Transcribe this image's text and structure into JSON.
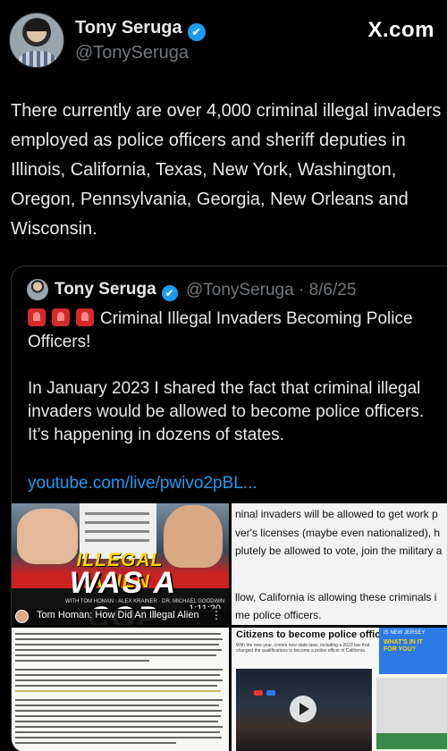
{
  "header": {
    "author_name": "Tony Seruga",
    "author_handle": "@TonySeruga",
    "site_brand": "X.com",
    "verified_icon": "✔"
  },
  "tweet": {
    "text": "There currently are over 4,000 criminal illegal invaders employed as police officers and sheriff deputies in Illinois, California, Texas, New York, Washington, Oregon, Pennsylvania, Georgia, New Orleans and Wisconsin."
  },
  "quote": {
    "author_name": "Tony Seruga",
    "handle_and_date": "@TonySeruga · 8/6/25",
    "verified_icon": "✔",
    "headline": "Criminal Illegal Invaders Becoming Police Officers!",
    "body": "In January 2023 I shared the fact that criminal illegal invaders would be allowed to become police officers. It’s happening in dozens of states.",
    "link": "youtube.com/live/pwivo2pBL..."
  },
  "media": {
    "video": {
      "headline_1": "ILLEGAL ALIEN",
      "headline_2": "WAS A COP",
      "credits": "WITH TOM HOMAN · ALEX KRAINER · DR. MICHAEL GOODWIN",
      "duration": "1:11:20",
      "caption": "Tom Homan: How Did An Illegal Alien",
      "more_icon": "⋮"
    },
    "text_snippet": {
      "lines": [
        "ninal invaders will be allowed to get work p",
        "ver's licenses (maybe even nationalized), h",
        "plutely be allowed to vote, join the military a",
        "llow, California is allowing these criminals i",
        "me police officers."
      ]
    },
    "news": {
      "title": "Citizens to become police officers",
      "body_1": "With the new year, comes new state laws, including a 2023 law that",
      "body_2": "changed the qualifications to become a police officer in California.",
      "ad_1": "IS NEW JERSEY",
      "ad_2": "WHAT'S IN IT FOR YOU?"
    }
  },
  "colors": {
    "background": "#000000",
    "text": "#e7e9ea",
    "secondary": "#71767b",
    "link": "#1d9bf0",
    "border": "#2f3336"
  }
}
